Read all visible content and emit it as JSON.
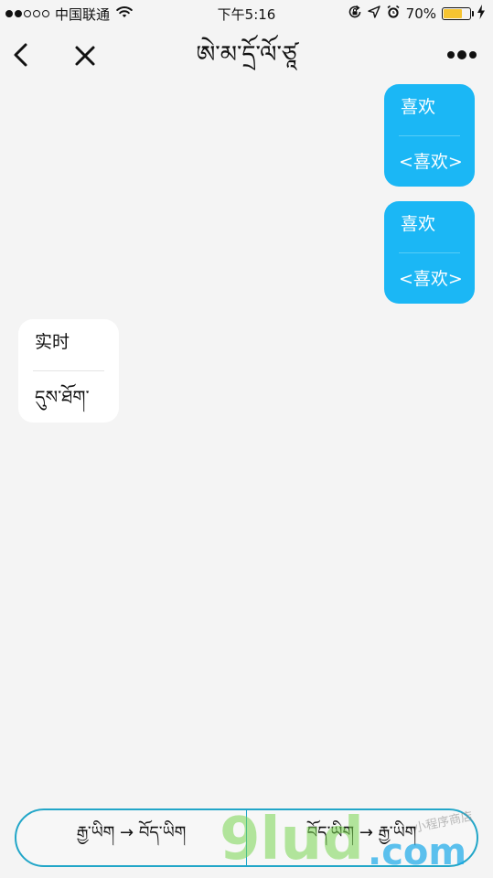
{
  "status_bar": {
    "carrier": "中国联通",
    "time": "下午5:16",
    "battery_percent": "70%",
    "battery_level": 0.7,
    "signal_bars_filled": 2,
    "signal_bars_total": 5
  },
  "nav": {
    "title": "ཨེ་མ་དྲོ་ལོ་ཙཱ"
  },
  "messages": [
    {
      "direction": "outgoing",
      "text": "喜欢",
      "translation": "<喜欢>"
    },
    {
      "direction": "outgoing",
      "text": "喜欢",
      "translation": "<喜欢>"
    },
    {
      "direction": "incoming",
      "text": "实时",
      "translation": "དུས་ཐོག་"
    }
  ],
  "mode_switch": {
    "left_label": "རྒྱ་ཡིག → བོད་ཡིག",
    "right_label": "བོད་ཡིག → རྒྱ་ཡིག"
  },
  "watermark": {
    "main": "9lud",
    "sub": ".com",
    "small": "小程序商店"
  },
  "colors": {
    "outgoing_bubble": "#1bb7f5",
    "incoming_bubble": "#ffffff",
    "switch_border": "#22a6c8",
    "background": "#f4f4f4"
  }
}
